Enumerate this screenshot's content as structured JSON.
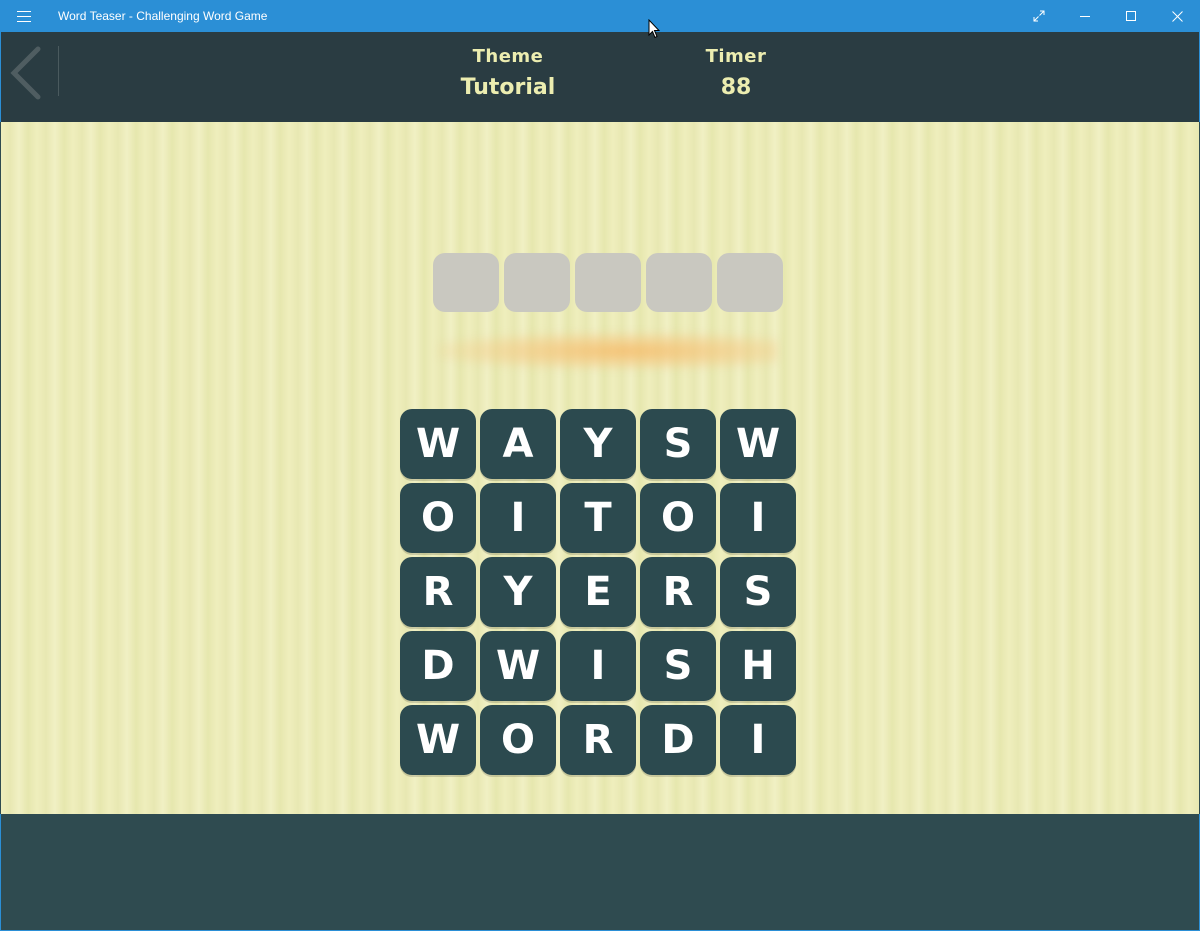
{
  "window": {
    "title": "Word Teaser - Challenging Word Game",
    "accent_color": "#2b8fd6",
    "controls": [
      "fullscreen-icon",
      "minimize-icon",
      "maximize-icon",
      "close-icon"
    ]
  },
  "header": {
    "back_icon": "chevron-left-icon",
    "theme_label": "Theme",
    "theme_value": "Tutorial",
    "timer_label": "Timer",
    "timer_value": "88",
    "text_color": "#ecedb0",
    "background": "#2a3c42"
  },
  "game": {
    "answer_slots": 5,
    "tile_color": "#2c4a4f",
    "grid": [
      [
        "W",
        "A",
        "Y",
        "S",
        "W"
      ],
      [
        "O",
        "I",
        "T",
        "O",
        "I"
      ],
      [
        "R",
        "Y",
        "E",
        "R",
        "S"
      ],
      [
        "D",
        "W",
        "I",
        "S",
        "H"
      ],
      [
        "W",
        "O",
        "R",
        "D",
        "I"
      ]
    ]
  }
}
